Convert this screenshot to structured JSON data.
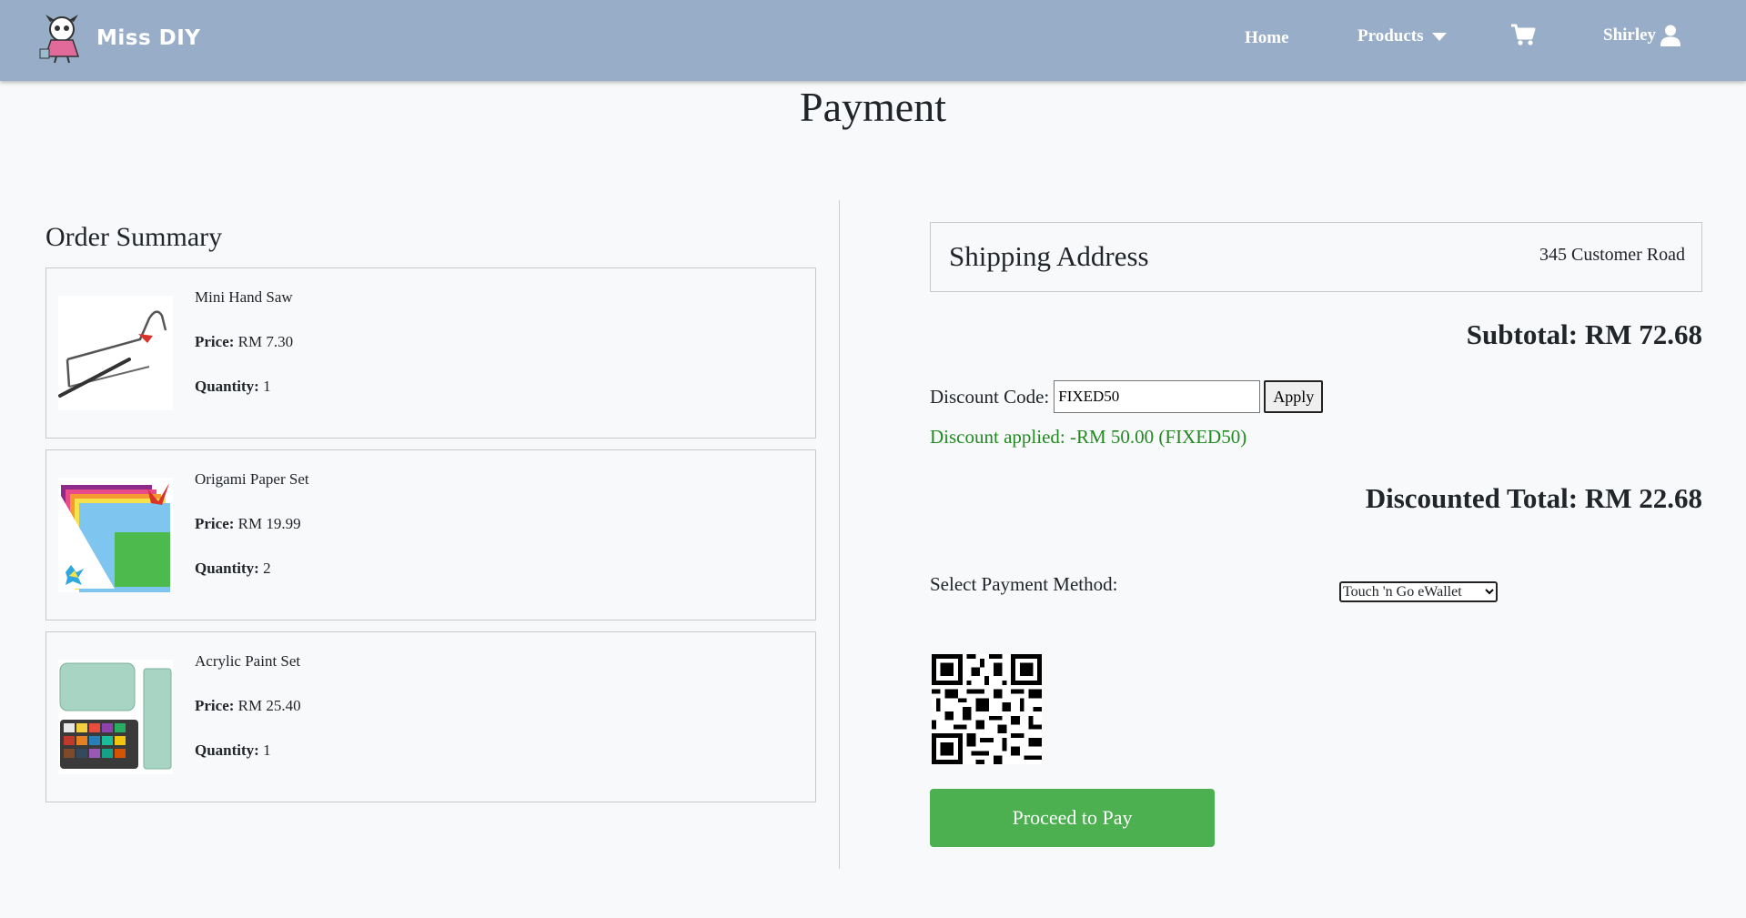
{
  "navbar": {
    "brand_name": "Miss DIY",
    "home_label": "Home",
    "products_label": "Products",
    "user_name": "Shirley",
    "bg_color": "#98aec8"
  },
  "page_title": "Payment",
  "order_summary": {
    "heading": "Order Summary",
    "price_label": "Price:",
    "quantity_label": "Quantity:",
    "items": [
      {
        "name": "Mini Hand Saw",
        "price": "RM 7.30",
        "quantity": "1",
        "image": "hand-saw"
      },
      {
        "name": "Origami Paper Set",
        "price": "RM 19.99",
        "quantity": "2",
        "image": "origami-paper"
      },
      {
        "name": "Acrylic Paint Set",
        "price": "RM 25.40",
        "quantity": "1",
        "image": "paint-set"
      }
    ]
  },
  "shipping": {
    "title": "Shipping Address",
    "address": "345 Customer Road"
  },
  "subtotal": "Subtotal: RM 72.68",
  "discount": {
    "label": "Discount Code:",
    "value": "FIXED50",
    "apply_label": "Apply",
    "message": "Discount applied: -RM 50.00 (FIXED50)",
    "message_color": "#218a21"
  },
  "discounted_total": "Discounted Total: RM 22.68",
  "payment": {
    "label": "Select Payment Method:",
    "selected": "Touch 'n Go eWallet",
    "button_label": "Proceed to Pay",
    "button_color": "#4caf50"
  }
}
